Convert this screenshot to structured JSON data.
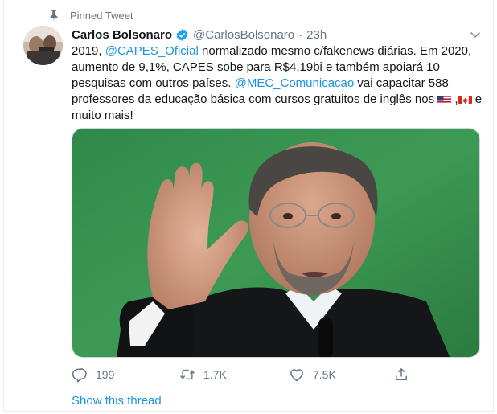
{
  "pinned": {
    "label": "Pinned Tweet"
  },
  "author": {
    "name": "Carlos Bolsonaro",
    "handle": "@CarlosBolsonaro",
    "separator": "·",
    "time": "23h"
  },
  "tweet": {
    "l1_pre": "2019, ",
    "l1_mention": "@CAPES_Oficial",
    "l1_post": " normalizado mesmo c/fakenews diárias. Em 2020,",
    "l2": "aumento de 9,1%, CAPES sobe para R$4,19bi e também apoiará 10",
    "l3_pre": "pesquisas com outros países. ",
    "l3_mention": "@MEC_Comunicacao",
    "l3_post": " vai capacitar 588",
    "l4_pre": "professores da educação básica com cursos gratuitos de inglês nos ",
    "l4_mid": " ,",
    "l4_post": " e",
    "l5": "muito mais!"
  },
  "actions": {
    "reply_count": "199",
    "retweet_count": "1.7K",
    "like_count": "7.5K"
  },
  "thread": {
    "label": "Show this thread"
  },
  "colors": {
    "accent": "#1b95e0",
    "muted": "#657786",
    "text": "#14171a"
  },
  "icons": [
    "pin-icon",
    "verified-icon",
    "caret-down-icon",
    "reply-icon",
    "retweet-icon",
    "like-icon",
    "share-icon",
    "us-flag-icon",
    "canada-flag-icon"
  ]
}
